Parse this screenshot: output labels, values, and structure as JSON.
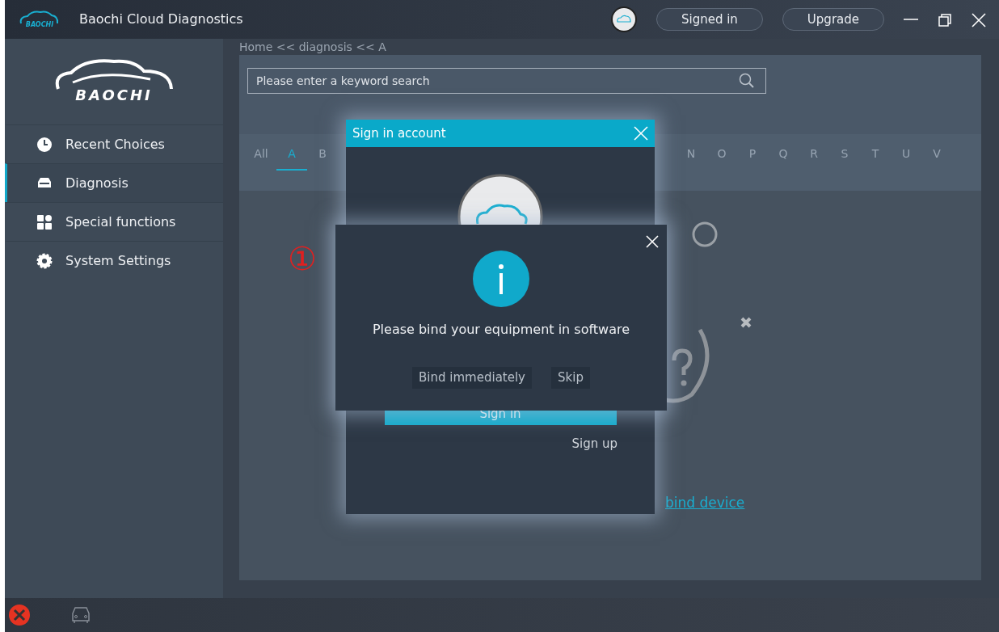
{
  "window": {
    "title": "Baochi Cloud Diagnostics",
    "logo_text": "BAOCHI",
    "buttons": [
      "Signed in",
      "Upgrade"
    ]
  },
  "sidebar": {
    "logo_text": "BAOCHI",
    "items": [
      {
        "label": "Recent Choices",
        "selected": false
      },
      {
        "label": "Diagnosis",
        "selected": true
      },
      {
        "label": "Special functions",
        "selected": false
      },
      {
        "label": "System Settings",
        "selected": false
      }
    ]
  },
  "breadcrumb": "Home << diagnosis << A",
  "search": {
    "placeholder": "Please enter a keyword search"
  },
  "letters_left": [
    {
      "label": "All",
      "selected": false
    },
    {
      "label": "A",
      "selected": true
    },
    {
      "label": "B",
      "selected": false
    }
  ],
  "letters_right": [
    {
      "label": "N",
      "selected": false
    },
    {
      "label": "O",
      "selected": false
    },
    {
      "label": "P",
      "selected": false
    },
    {
      "label": "Q",
      "selected": false
    },
    {
      "label": "R",
      "selected": false
    },
    {
      "label": "S",
      "selected": false
    },
    {
      "label": "T",
      "selected": false
    },
    {
      "label": "U",
      "selected": false
    },
    {
      "label": "V",
      "selected": false
    }
  ],
  "bind_link": "bind device",
  "sign_in_dialog": {
    "title": "Sign in account",
    "sign_in": "Sign in",
    "sign_up": "Sign up"
  },
  "bind_dialog": {
    "message": "Please bind your equipment in software",
    "buttons": [
      "Bind immediately",
      "Skip"
    ]
  },
  "annotation": "①"
}
